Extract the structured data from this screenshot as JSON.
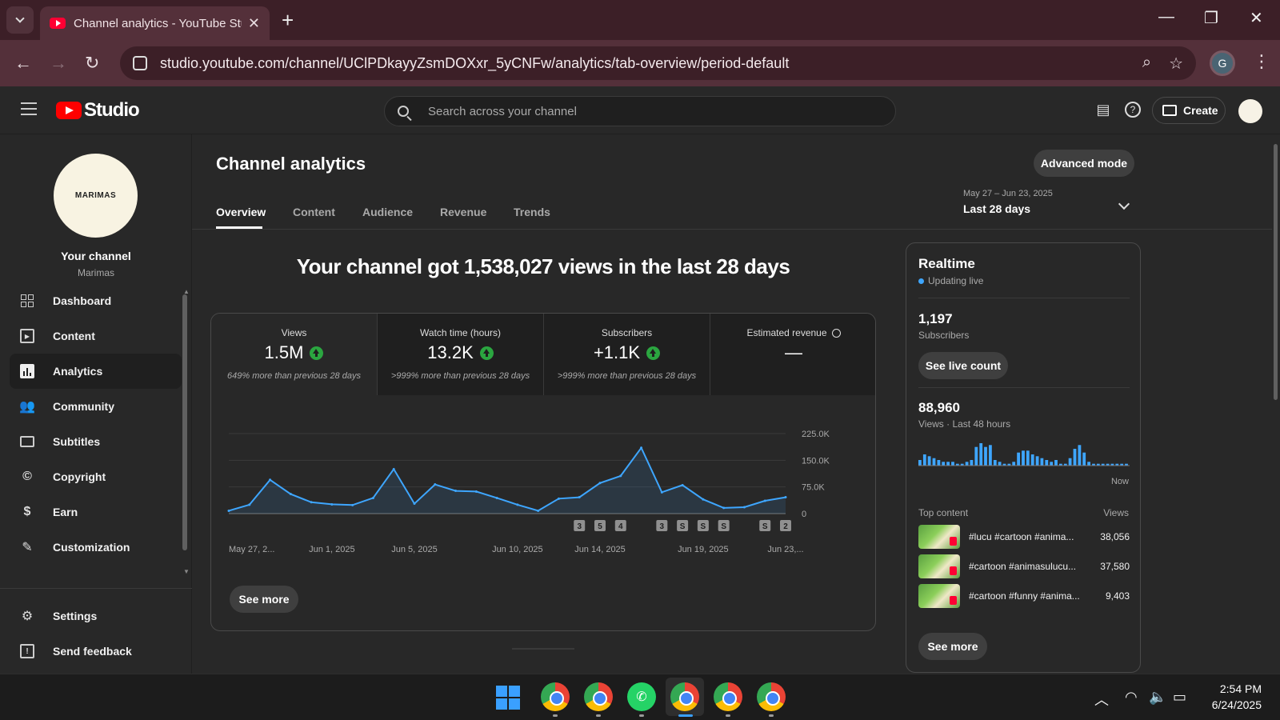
{
  "browser": {
    "tab_title": "Channel analytics - YouTube Studio",
    "tab_close": "✕",
    "new_tab": "+",
    "url": "studio.youtube.com/channel/UClPDkayyZsmDOXxr_5yCNFw/analytics/tab-overview/period-default",
    "profile_initial": "G",
    "back_icon": "←",
    "forward_icon": "→",
    "reload_icon": "↻",
    "zoom_icon": "⌕",
    "star_icon": "☆",
    "kebab_icon": "⋮",
    "minimize": "—",
    "restore": "❐",
    "close": "✕"
  },
  "studio": {
    "logo_text": "Studio",
    "search_placeholder": "Search across your channel",
    "create_label": "Create",
    "notif_icon": "▤",
    "help_icon": "?"
  },
  "sidebar": {
    "channel_avatar_text": "MARIMAS",
    "your_channel": "Your channel",
    "channel_name": "Marimas",
    "items": [
      {
        "label": "Dashboard",
        "icon": "dashboard-icon"
      },
      {
        "label": "Content",
        "icon": "content-icon"
      },
      {
        "label": "Analytics",
        "icon": "analytics-icon",
        "active": true
      },
      {
        "label": "Community",
        "icon": "community-icon"
      },
      {
        "label": "Subtitles",
        "icon": "subtitles-icon"
      },
      {
        "label": "Copyright",
        "icon": "copyright-icon"
      },
      {
        "label": "Earn",
        "icon": "earn-icon"
      },
      {
        "label": "Customization",
        "icon": "customization-icon"
      }
    ],
    "bottom_items": [
      {
        "label": "Settings",
        "icon": "settings-icon"
      },
      {
        "label": "Send feedback",
        "icon": "feedback-icon"
      }
    ]
  },
  "main": {
    "title": "Channel analytics",
    "advanced_mode": "Advanced mode",
    "tabs": [
      "Overview",
      "Content",
      "Audience",
      "Revenue",
      "Trends"
    ],
    "active_tab": "Overview",
    "date_range": "May 27 – Jun 23, 2025",
    "period": "Last 28 days",
    "headline": "Your channel got 1,538,027 views in the last 28 days",
    "metrics": [
      {
        "label": "Views",
        "value": "1.5M",
        "trend": "up",
        "sub": "649% more than previous 28 days"
      },
      {
        "label": "Watch time (hours)",
        "value": "13.2K",
        "trend": "up",
        "sub": ">999% more than previous 28 days"
      },
      {
        "label": "Subscribers",
        "value": "+1.1K",
        "trend": "up",
        "sub": ">999% more than previous 28 days"
      },
      {
        "label": "Estimated revenue",
        "value": "—",
        "trend": "none",
        "sub": ""
      }
    ],
    "see_more": "See more"
  },
  "chart_data": {
    "type": "area",
    "x": [
      "May 27",
      "May 28",
      "May 29",
      "May 30",
      "May 31",
      "Jun 1",
      "Jun 2",
      "Jun 3",
      "Jun 4",
      "Jun 5",
      "Jun 6",
      "Jun 7",
      "Jun 8",
      "Jun 9",
      "Jun 10",
      "Jun 11",
      "Jun 12",
      "Jun 13",
      "Jun 14",
      "Jun 15",
      "Jun 16",
      "Jun 17",
      "Jun 18",
      "Jun 19",
      "Jun 20",
      "Jun 21",
      "Jun 22",
      "Jun 23"
    ],
    "series": [
      {
        "values": [
          8000,
          25000,
          95000,
          55000,
          32000,
          26000,
          24000,
          44000,
          125000,
          28000,
          82000,
          64000,
          62000,
          44000,
          25000,
          8000,
          42000,
          46000,
          86000,
          106000,
          185000,
          60000,
          80000,
          40000,
          16000,
          18000,
          36000,
          46000
        ]
      }
    ],
    "x_tick_labels": [
      "May 27, 2...",
      "Jun 1, 2025",
      "Jun 5, 2025",
      "Jun 10, 2025",
      "Jun 14, 2025",
      "Jun 19, 2025",
      "Jun 23,..."
    ],
    "x_tick_index": [
      0,
      5,
      9,
      14,
      18,
      23,
      27
    ],
    "y_ticks": [
      0,
      75000,
      150000,
      225000
    ],
    "y_tick_labels": [
      "0",
      "75.0K",
      "150.0K",
      "225.0K"
    ],
    "ylim": [
      0,
      225000
    ],
    "grid": true,
    "color": "#3ea6ff",
    "upload_markers": [
      {
        "index": 17,
        "label": "3"
      },
      {
        "index": 18,
        "label": "5"
      },
      {
        "index": 19,
        "label": "4"
      },
      {
        "index": 21,
        "label": "3"
      },
      {
        "index": 22,
        "label": "shorts"
      },
      {
        "index": 23,
        "label": "shorts"
      },
      {
        "index": 24,
        "label": "shorts"
      },
      {
        "index": 26,
        "label": "shorts"
      },
      {
        "index": 27,
        "label": "2"
      }
    ]
  },
  "realtime": {
    "title": "Realtime",
    "status": "Updating live",
    "subscribers": "1,197",
    "subscribers_label": "Subscribers",
    "see_live_count": "See live count",
    "views": "88,960",
    "views_label": "Views · Last 48 hours",
    "now_label": "Now",
    "bars": [
      3,
      6,
      5,
      4,
      3,
      2,
      2,
      2,
      1,
      1,
      2,
      3,
      10,
      12,
      10,
      11,
      3,
      2,
      1,
      1,
      2,
      7,
      8,
      8,
      6,
      5,
      4,
      3,
      2,
      3,
      1,
      1,
      4,
      9,
      11,
      7,
      2,
      1,
      1,
      1,
      1,
      1,
      1,
      1,
      1
    ],
    "top_content_label": "Top content",
    "top_content_views_label": "Views",
    "top_content": [
      {
        "title": "#lucu #cartoon #anima...",
        "views": "38,056"
      },
      {
        "title": "#cartoon #animasulucu...",
        "views": "37,580"
      },
      {
        "title": "#cartoon #funny #anima...",
        "views": "9,403"
      }
    ],
    "see_more": "See more"
  },
  "taskbar": {
    "time": "2:54 PM",
    "date": "6/24/2025",
    "whatsapp_glyph": "✆",
    "tray_chevron": "︿",
    "wifi_icon": "◠",
    "volume_icon": "🔈",
    "battery_icon": "▭"
  }
}
